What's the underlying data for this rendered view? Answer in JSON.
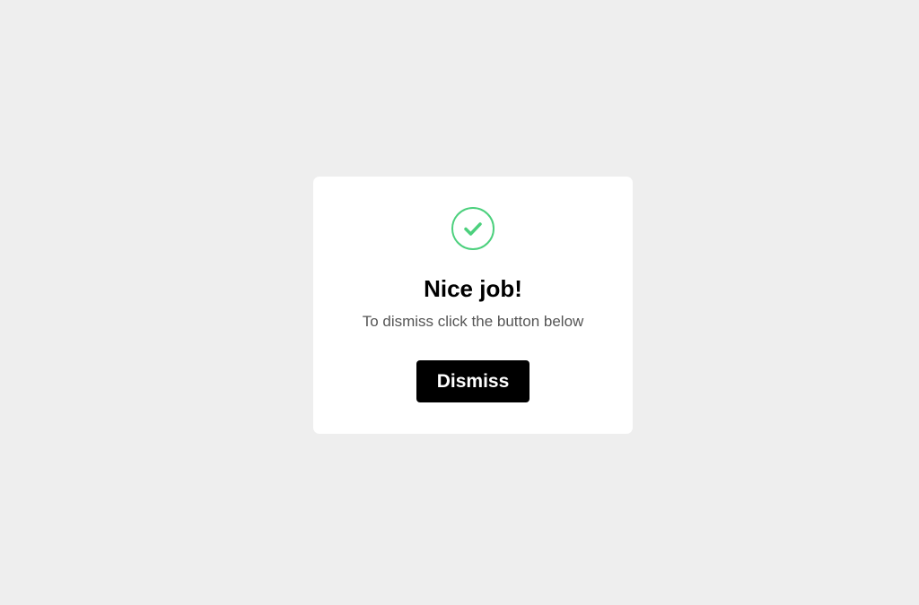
{
  "modal": {
    "icon": "check-circle-icon",
    "icon_color": "#4cd07d",
    "title": "Nice job!",
    "subtitle": "To dismiss click the button below",
    "button_label": "Dismiss"
  },
  "colors": {
    "page_background": "#eeeeee",
    "modal_background": "#ffffff",
    "button_background": "#000000",
    "button_text": "#ffffff"
  }
}
